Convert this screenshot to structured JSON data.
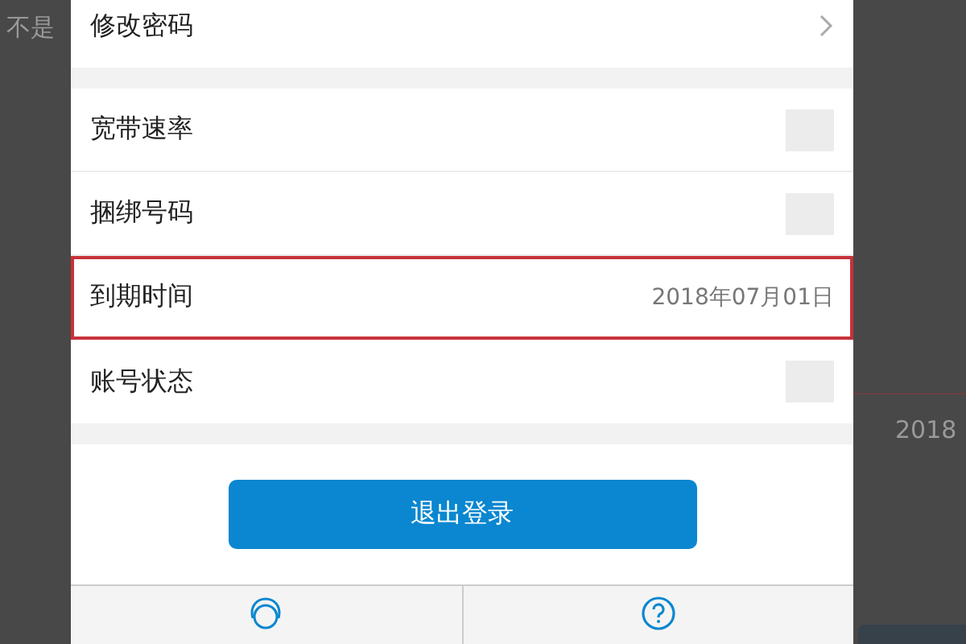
{
  "background": {
    "left_text": "不是",
    "right_text": "2018"
  },
  "sections": [
    {
      "rows": [
        {
          "label": "修改密码",
          "kind": "link",
          "highlighted": false
        }
      ]
    },
    {
      "rows": [
        {
          "label": "宽带速率",
          "kind": "redacted",
          "highlighted": false
        },
        {
          "label": "捆绑号码",
          "kind": "redacted",
          "highlighted": false
        },
        {
          "label": "到期时间",
          "kind": "value",
          "value": "2018年07月01日",
          "highlighted": true
        },
        {
          "label": "账号状态",
          "kind": "redacted",
          "highlighted": false
        }
      ]
    }
  ],
  "logout_button": "退出登录",
  "bottom_tabs": [
    {
      "kind": "service"
    },
    {
      "kind": "help"
    }
  ]
}
